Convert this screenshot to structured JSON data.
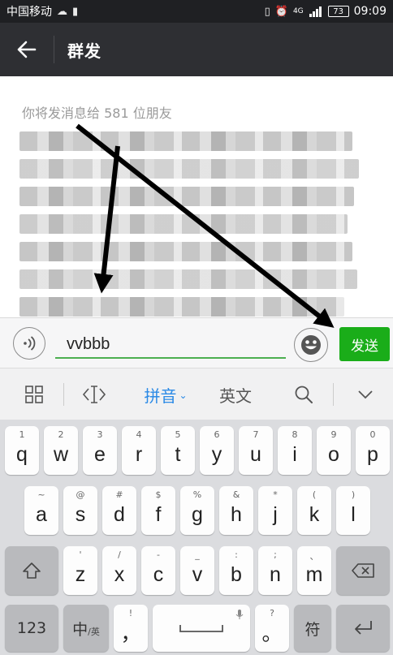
{
  "status_bar": {
    "carrier": "中国移动",
    "network": "4G",
    "battery": "73",
    "time": "09:09"
  },
  "header": {
    "title": "群发"
  },
  "broadcast": {
    "recipient_label": "你将发消息给 581 位朋友"
  },
  "input_bar": {
    "text_value": "vvbbb",
    "send_label": "发送"
  },
  "ime_toolbar": {
    "pinyin_label": "拼音",
    "english_label": "英文"
  },
  "keyboard": {
    "row1": [
      {
        "sub": "1",
        "main": "q"
      },
      {
        "sub": "2",
        "main": "w"
      },
      {
        "sub": "3",
        "main": "e"
      },
      {
        "sub": "4",
        "main": "r"
      },
      {
        "sub": "5",
        "main": "t"
      },
      {
        "sub": "6",
        "main": "y"
      },
      {
        "sub": "7",
        "main": "u"
      },
      {
        "sub": "8",
        "main": "i"
      },
      {
        "sub": "9",
        "main": "o"
      },
      {
        "sub": "0",
        "main": "p"
      }
    ],
    "row2": [
      {
        "sub": "~",
        "main": "a"
      },
      {
        "sub": "@",
        "main": "s"
      },
      {
        "sub": "#",
        "main": "d"
      },
      {
        "sub": "$",
        "main": "f"
      },
      {
        "sub": "%",
        "main": "g"
      },
      {
        "sub": "&",
        "main": "h"
      },
      {
        "sub": "*",
        "main": "j"
      },
      {
        "sub": "(",
        "main": "k"
      },
      {
        "sub": ")",
        "main": "l"
      }
    ],
    "row3": [
      {
        "sub": "'",
        "main": "z"
      },
      {
        "sub": "/",
        "main": "x"
      },
      {
        "sub": "-",
        "main": "c"
      },
      {
        "sub": "_",
        "main": "v"
      },
      {
        "sub": ":",
        "main": "b"
      },
      {
        "sub": ";",
        "main": "n"
      },
      {
        "sub": "、",
        "main": "m"
      }
    ],
    "num_label": "123",
    "lang_label": "中",
    "lang_sub": "/英",
    "comma_main": "，",
    "comma_sub": "!",
    "period_main": "。",
    "period_sub": "?",
    "symbol_label": "符"
  },
  "colors": {
    "send_green": "#1aad19",
    "titlebar": "#2e2f33",
    "input_underline": "#4caf50",
    "pinyin_blue": "#2b8ae6"
  }
}
